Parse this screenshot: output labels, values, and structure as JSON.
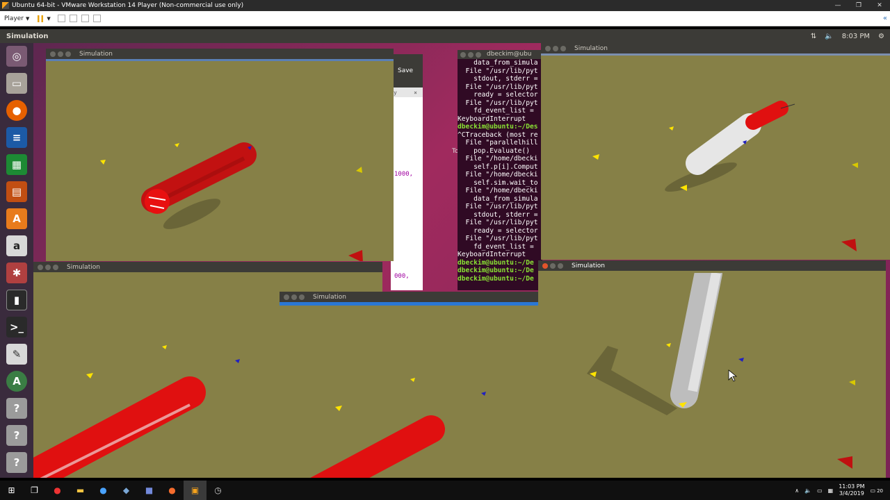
{
  "vm": {
    "title": "Ubuntu 64-bit - VMware Workstation 14 Player (Non-commercial use only)",
    "player_label": "Player",
    "window_controls": [
      "—",
      "❐",
      "✕"
    ]
  },
  "ubuntu_panel": {
    "app_title": "Simulation",
    "time": "8:03 PM"
  },
  "windows": {
    "sim1": {
      "title": "Simulation"
    },
    "sim2": {
      "title": "Simulation"
    },
    "sim3": {
      "title": "Simulation"
    },
    "sim4": {
      "title": "Simulation"
    },
    "sim5": {
      "title": "Simulation"
    }
  },
  "editor": {
    "save_label": "Save",
    "tab_label": "y",
    "close": "×",
    "val1": "1000,",
    "val2": "000,",
    "side_label": "To"
  },
  "terminal": {
    "title": "dbeckim@ubu",
    "lines": [
      {
        "text": "    data_from_simula",
        "prompt": false
      },
      {
        "text": "  File \"/usr/lib/pyt",
        "prompt": false
      },
      {
        "text": "    stdout, stderr =",
        "prompt": false
      },
      {
        "text": "  File \"/usr/lib/pyt",
        "prompt": false
      },
      {
        "text": "    ready = selector",
        "prompt": false
      },
      {
        "text": "  File \"/usr/lib/pyt",
        "prompt": false
      },
      {
        "text": "    fd_event_list =",
        "prompt": false
      },
      {
        "text": "KeyboardInterrupt",
        "prompt": false
      },
      {
        "text": "dbeckim@ubuntu:~/Des",
        "prompt": true
      },
      {
        "text": "^CTraceback (most re",
        "prompt": false
      },
      {
        "text": "  File \"parallelhill",
        "prompt": false
      },
      {
        "text": "    pop.Evaluate()",
        "prompt": false
      },
      {
        "text": "  File \"/home/dbecki",
        "prompt": false
      },
      {
        "text": "    self.p[i].Comput",
        "prompt": false
      },
      {
        "text": "  File \"/home/dbecki",
        "prompt": false
      },
      {
        "text": "    self.sim.wait_to",
        "prompt": false
      },
      {
        "text": "  File \"/home/dbecki",
        "prompt": false
      },
      {
        "text": "    data_from_simula",
        "prompt": false
      },
      {
        "text": "  File \"/usr/lib/pyt",
        "prompt": false
      },
      {
        "text": "    stdout, stderr =",
        "prompt": false
      },
      {
        "text": "  File \"/usr/lib/pyt",
        "prompt": false
      },
      {
        "text": "    ready = selector",
        "prompt": false
      },
      {
        "text": "  File \"/usr/lib/pyt",
        "prompt": false
      },
      {
        "text": "    fd_event_list =",
        "prompt": false
      },
      {
        "text": "KeyboardInterrupt",
        "prompt": false
      },
      {
        "text": "dbeckim@ubuntu:~/De",
        "prompt": true
      },
      {
        "text": "dbeckim@ubuntu:~/De",
        "prompt": true
      },
      {
        "text": "dbeckim@ubuntu:~/De",
        "prompt": true
      }
    ]
  },
  "taskbar": {
    "time": "11:03 PM",
    "date": "3/4/2019",
    "notification_count": "20"
  },
  "colors": {
    "ground": "#868047",
    "robot_red": "#e81010",
    "robot_white": "#e6e6e6",
    "panel": "#3c3b37"
  }
}
